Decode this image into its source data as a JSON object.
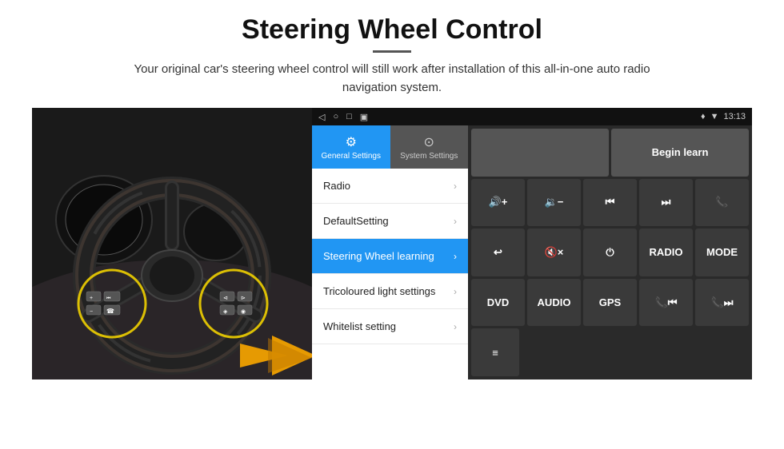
{
  "header": {
    "title": "Steering Wheel Control",
    "subtitle": "Your original car's steering wheel control will still work after installation of this all-in-one auto radio navigation system.",
    "divider": true
  },
  "statusBar": {
    "time": "13:13",
    "icons": [
      "◁",
      "○",
      "□",
      "▣"
    ],
    "rightIcons": [
      "♦",
      "▼"
    ]
  },
  "tabs": [
    {
      "id": "general",
      "label": "General Settings",
      "icon": "⚙",
      "active": true
    },
    {
      "id": "system",
      "label": "System Settings",
      "icon": "⊙",
      "active": false
    }
  ],
  "menuItems": [
    {
      "id": "radio",
      "label": "Radio",
      "active": false
    },
    {
      "id": "default",
      "label": "DefaultSetting",
      "active": false
    },
    {
      "id": "steering",
      "label": "Steering Wheel learning",
      "active": true
    },
    {
      "id": "tricoloured",
      "label": "Tricoloured light settings",
      "active": false
    },
    {
      "id": "whitelist",
      "label": "Whitelist setting",
      "active": false
    }
  ],
  "controlButtons": {
    "row1": [
      {
        "id": "empty1",
        "label": "",
        "type": "empty",
        "wide": true
      },
      {
        "id": "begin-learn",
        "label": "Begin learn",
        "type": "begin-learn",
        "wide": true
      }
    ],
    "row2": [
      {
        "id": "vol-up",
        "label": "🔊+",
        "symbol": "🔊+"
      },
      {
        "id": "vol-down",
        "label": "🔉−",
        "symbol": "🔉−"
      },
      {
        "id": "prev",
        "label": "⏮",
        "symbol": "⏮"
      },
      {
        "id": "next",
        "label": "⏭",
        "symbol": "⏭"
      },
      {
        "id": "phone",
        "label": "📞",
        "symbol": "📞"
      }
    ],
    "row3": [
      {
        "id": "hang-up",
        "label": "↩",
        "symbol": "↩"
      },
      {
        "id": "mute",
        "label": "🔇x",
        "symbol": "🔇×"
      },
      {
        "id": "power",
        "label": "⏻",
        "symbol": "⏻"
      },
      {
        "id": "radio-btn",
        "label": "RADIO",
        "symbol": "RADIO"
      },
      {
        "id": "mode-btn",
        "label": "MODE",
        "symbol": "MODE"
      }
    ],
    "row4": [
      {
        "id": "dvd-btn",
        "label": "DVD",
        "symbol": "DVD"
      },
      {
        "id": "audio-btn",
        "label": "AUDIO",
        "symbol": "AUDIO"
      },
      {
        "id": "gps-btn",
        "label": "GPS",
        "symbol": "GPS"
      },
      {
        "id": "phone-prev",
        "label": "📞⏮",
        "symbol": "📞⏮"
      },
      {
        "id": "phone-next",
        "label": "📞⏭",
        "symbol": "📞⏭"
      }
    ],
    "row5": [
      {
        "id": "list-icon",
        "label": "≡",
        "symbol": "≡",
        "wide": false,
        "single": true
      }
    ]
  }
}
